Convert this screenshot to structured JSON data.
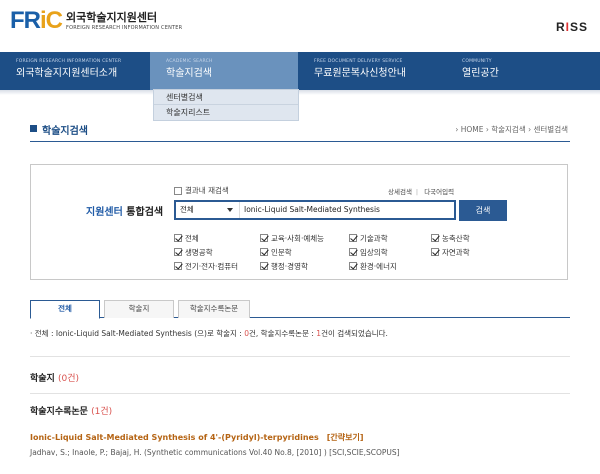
{
  "header": {
    "logo_main": "FR",
    "logo_ic": "iC",
    "logo_kr": "외국학술지지원센터",
    "logo_en": "FOREIGN RESEARCH INFORMATION CENTER",
    "riss_pre": "R",
    "riss_i": "I",
    "riss_post": "SS"
  },
  "nav": [
    {
      "sub": "FOREIGN RESEARCH INFORMATION CENTER",
      "label": "외국학술지지원센터소개"
    },
    {
      "sub": "ACADEMIC SEARCH",
      "label": "학술지검색"
    },
    {
      "sub": "FREE DOCUMENT DELIVERY SERVICE",
      "label": "무료원문복사신청안내"
    },
    {
      "sub": "COMMUNITY",
      "label": "열린공간"
    }
  ],
  "dropdown": [
    "센터별검색",
    "학술지리스트"
  ],
  "page": {
    "title": "학술지검색",
    "breadcrumb": "› HOME › 학술지검색 › 센터별검색"
  },
  "search": {
    "research_label": "결과내 재검색",
    "adv_search": "상세검색",
    "multi_lang": "다국어입력",
    "label_blue": "지원센터",
    "label_rest": " 통합검색",
    "scope": "전체",
    "query": "Ionic-Liquid Salt-Mediated Synthesis",
    "button": "검색",
    "categories": [
      "전체",
      "교육·사회·예체능",
      "기술과학",
      "농축산학",
      "생명공학",
      "인문학",
      "임상의학",
      "자연과학",
      "전기·전자·컴퓨터",
      "행정·경영학",
      "환경·에너지"
    ]
  },
  "tabs": [
    "전체",
    "학술지",
    "학술지수록논문"
  ],
  "summary": {
    "prefix": "· 전체 : Ionic-Liquid Salt-Mediated Synthesis (으)로 학술지 : ",
    "journal_count": "0",
    "mid": "건, 학술지수록논문 : ",
    "article_count": "1",
    "suffix": "건이 검색되었습니다."
  },
  "sections": {
    "journal_title": "학술지",
    "journal_count": "(0건)",
    "article_title": "학술지수록논문",
    "article_count": "(1건)"
  },
  "result": {
    "title": "Ionic-Liquid Salt-Mediated Synthesis of 4'-(Pyridyl)-terpyridines",
    "abstract_link": "[간략보기]",
    "meta": "Jadhav, S.; Inaole, P.; Bajaj, H. (Synthetic communications Vol.40 No.8, [2010] ) [SCI,SCIE,SCOPUS]"
  }
}
